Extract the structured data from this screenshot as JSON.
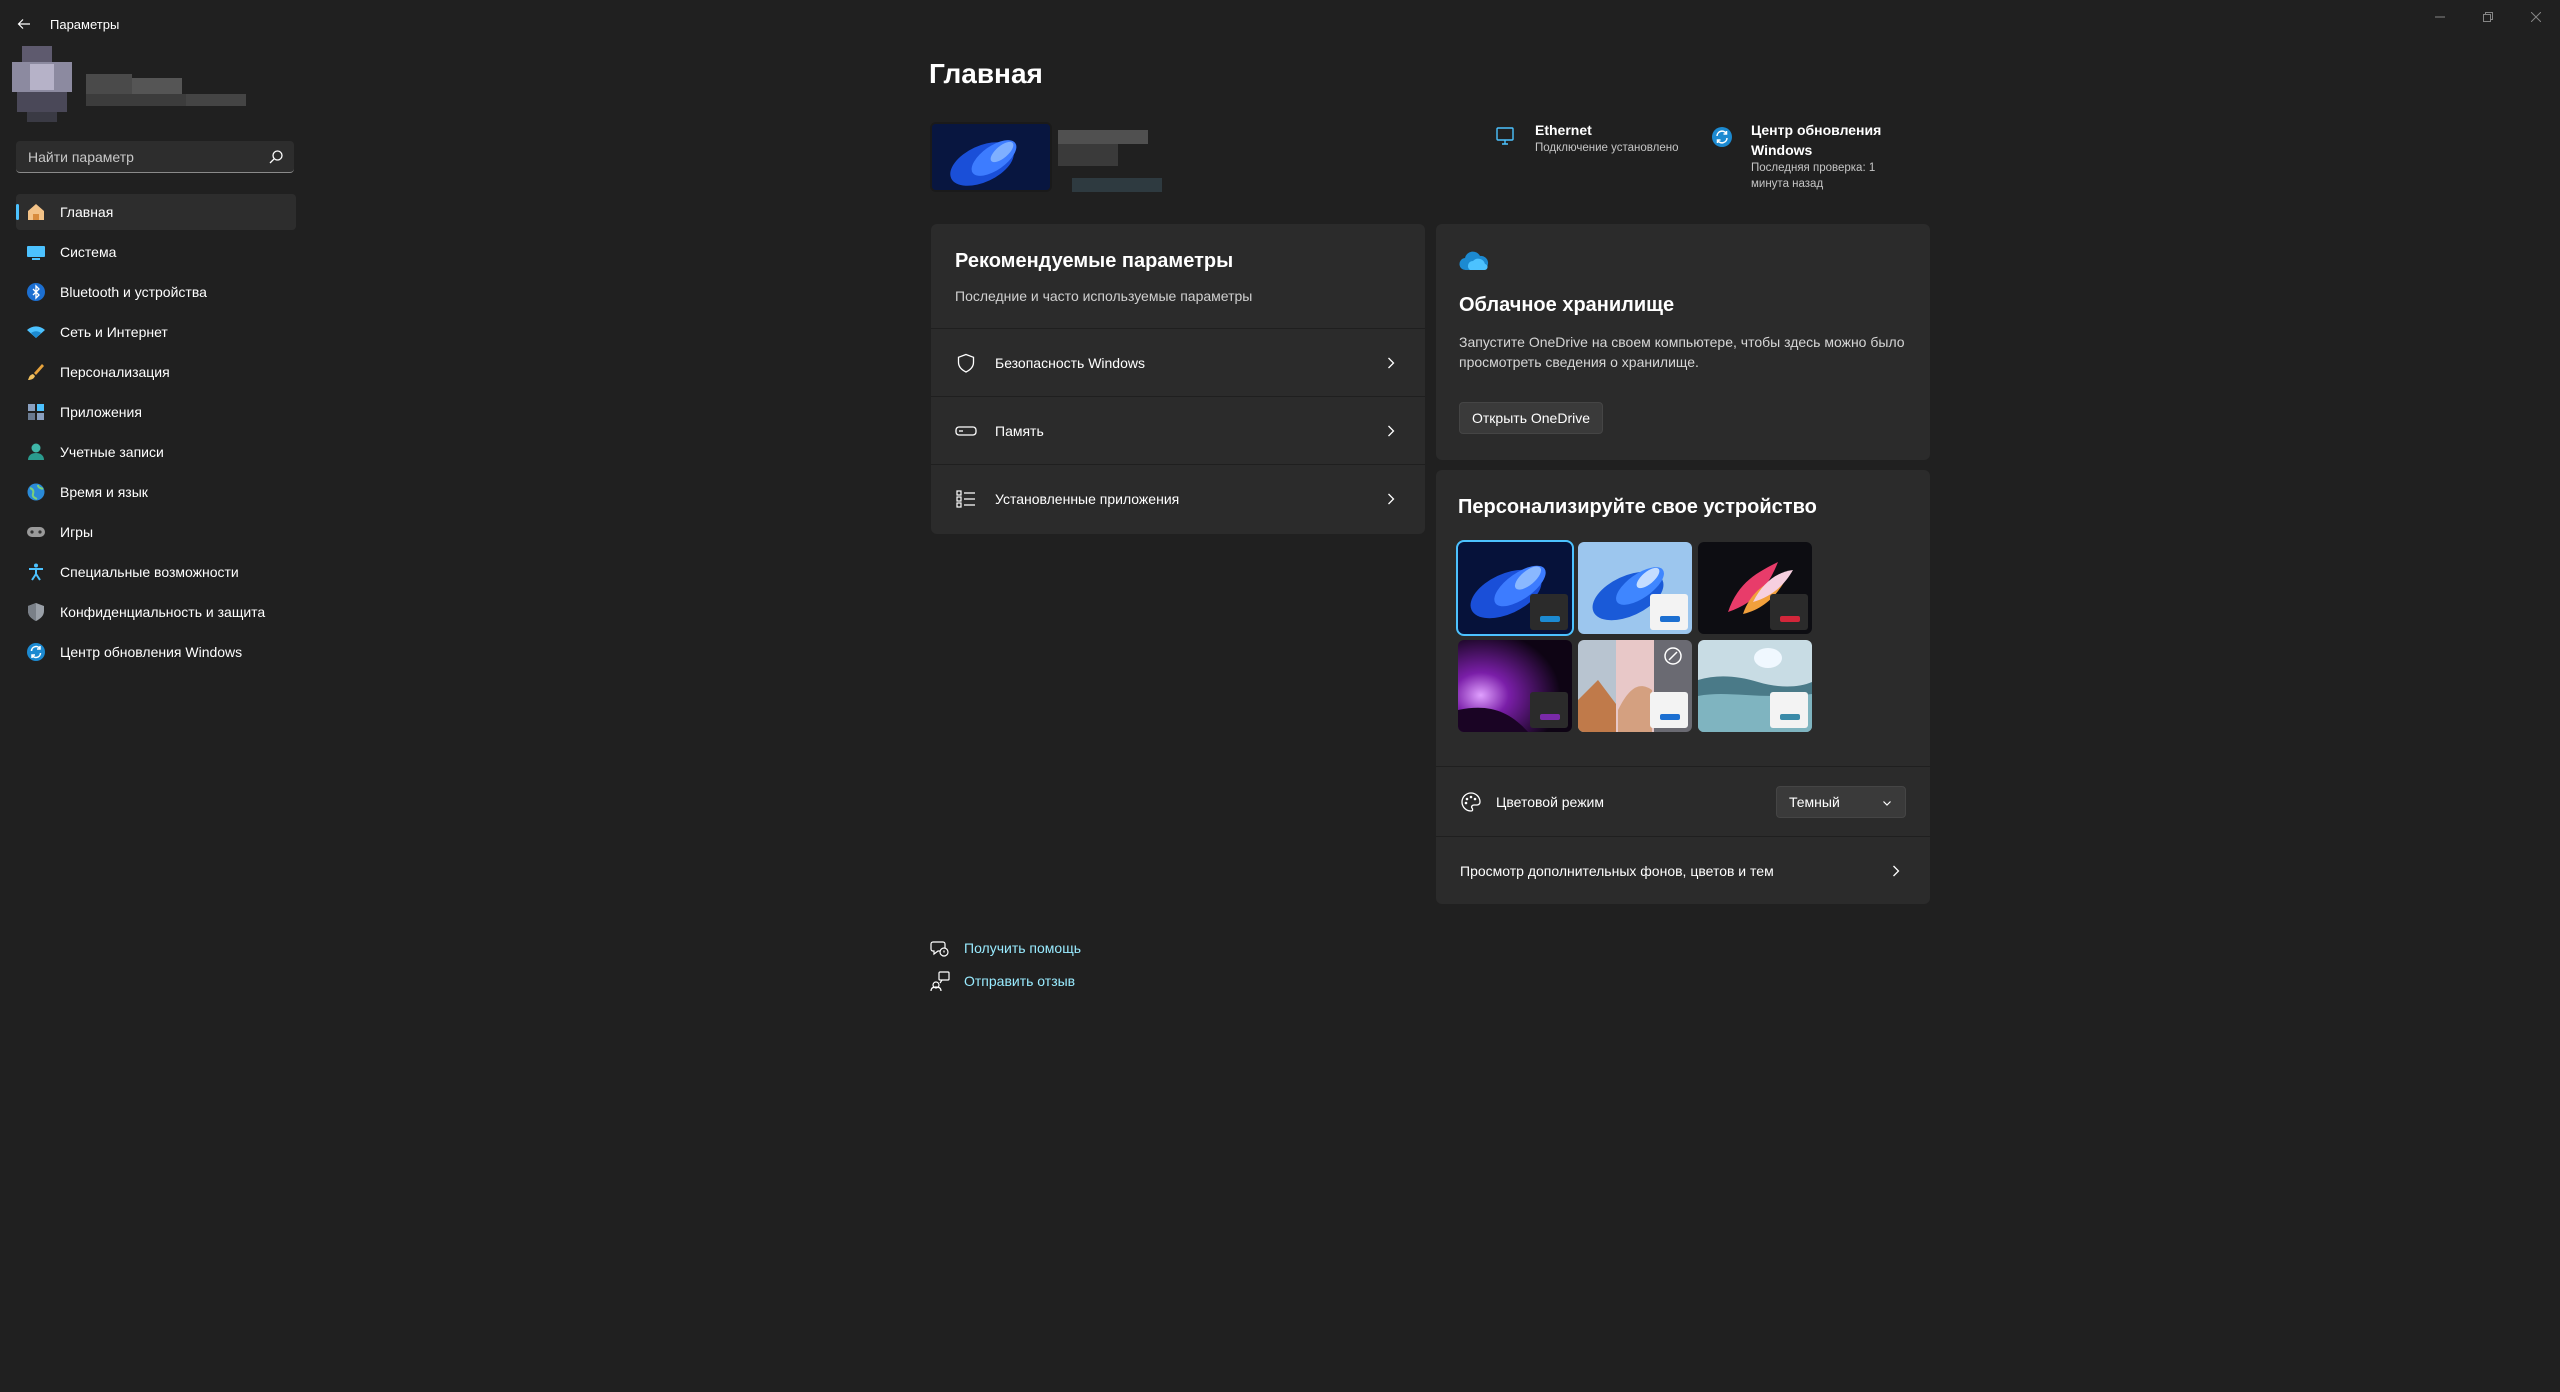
{
  "window": {
    "title": "Параметры"
  },
  "sidebar": {
    "search_placeholder": "Найти параметр",
    "items": [
      {
        "label": "Главная",
        "icon": "home-icon",
        "active": true
      },
      {
        "label": "Система",
        "icon": "system-icon"
      },
      {
        "label": "Bluetooth и устройства",
        "icon": "bluetooth-icon"
      },
      {
        "label": "Сеть и Интернет",
        "icon": "wifi-icon"
      },
      {
        "label": "Персонализация",
        "icon": "brush-icon"
      },
      {
        "label": "Приложения",
        "icon": "apps-icon"
      },
      {
        "label": "Учетные записи",
        "icon": "account-icon"
      },
      {
        "label": "Время и язык",
        "icon": "globe-icon"
      },
      {
        "label": "Игры",
        "icon": "gamepad-icon"
      },
      {
        "label": "Специальные возможности",
        "icon": "accessibility-icon"
      },
      {
        "label": "Конфиденциальность и защита",
        "icon": "shield-icon"
      },
      {
        "label": "Центр обновления Windows",
        "icon": "update-icon"
      }
    ]
  },
  "main": {
    "title": "Главная",
    "status": {
      "ethernet": {
        "title": "Ethernet",
        "sub": "Подключение установлено"
      },
      "update": {
        "title": "Центр обновления Windows",
        "sub": "Последняя проверка: 1 минута назад"
      }
    },
    "recommended": {
      "title": "Рекомендуемые параметры",
      "subtitle": "Последние и часто используемые параметры",
      "items": [
        {
          "label": "Безопасность Windows",
          "icon": "shield-outline-icon"
        },
        {
          "label": "Память",
          "icon": "storage-icon"
        },
        {
          "label": "Установленные приложения",
          "icon": "list-icon"
        }
      ]
    },
    "cloud": {
      "title": "Облачное хранилище",
      "description": "Запустите OneDrive на своем компьютере, чтобы здесь можно было просмотреть сведения о хранилище.",
      "button": "Открыть OneDrive"
    },
    "personalize": {
      "title": "Персонализируйте свое устройство",
      "color_mode_label": "Цветовой режим",
      "color_mode_value": "Темный",
      "more_link": "Просмотр дополнительных фонов, цветов и тем"
    },
    "help": {
      "get_help": "Получить помощь",
      "feedback": "Отправить отзыв"
    }
  },
  "colors": {
    "background": "#202020",
    "card": "#2b2b2b",
    "accent": "#4cc2ff",
    "link": "#99ebff"
  }
}
